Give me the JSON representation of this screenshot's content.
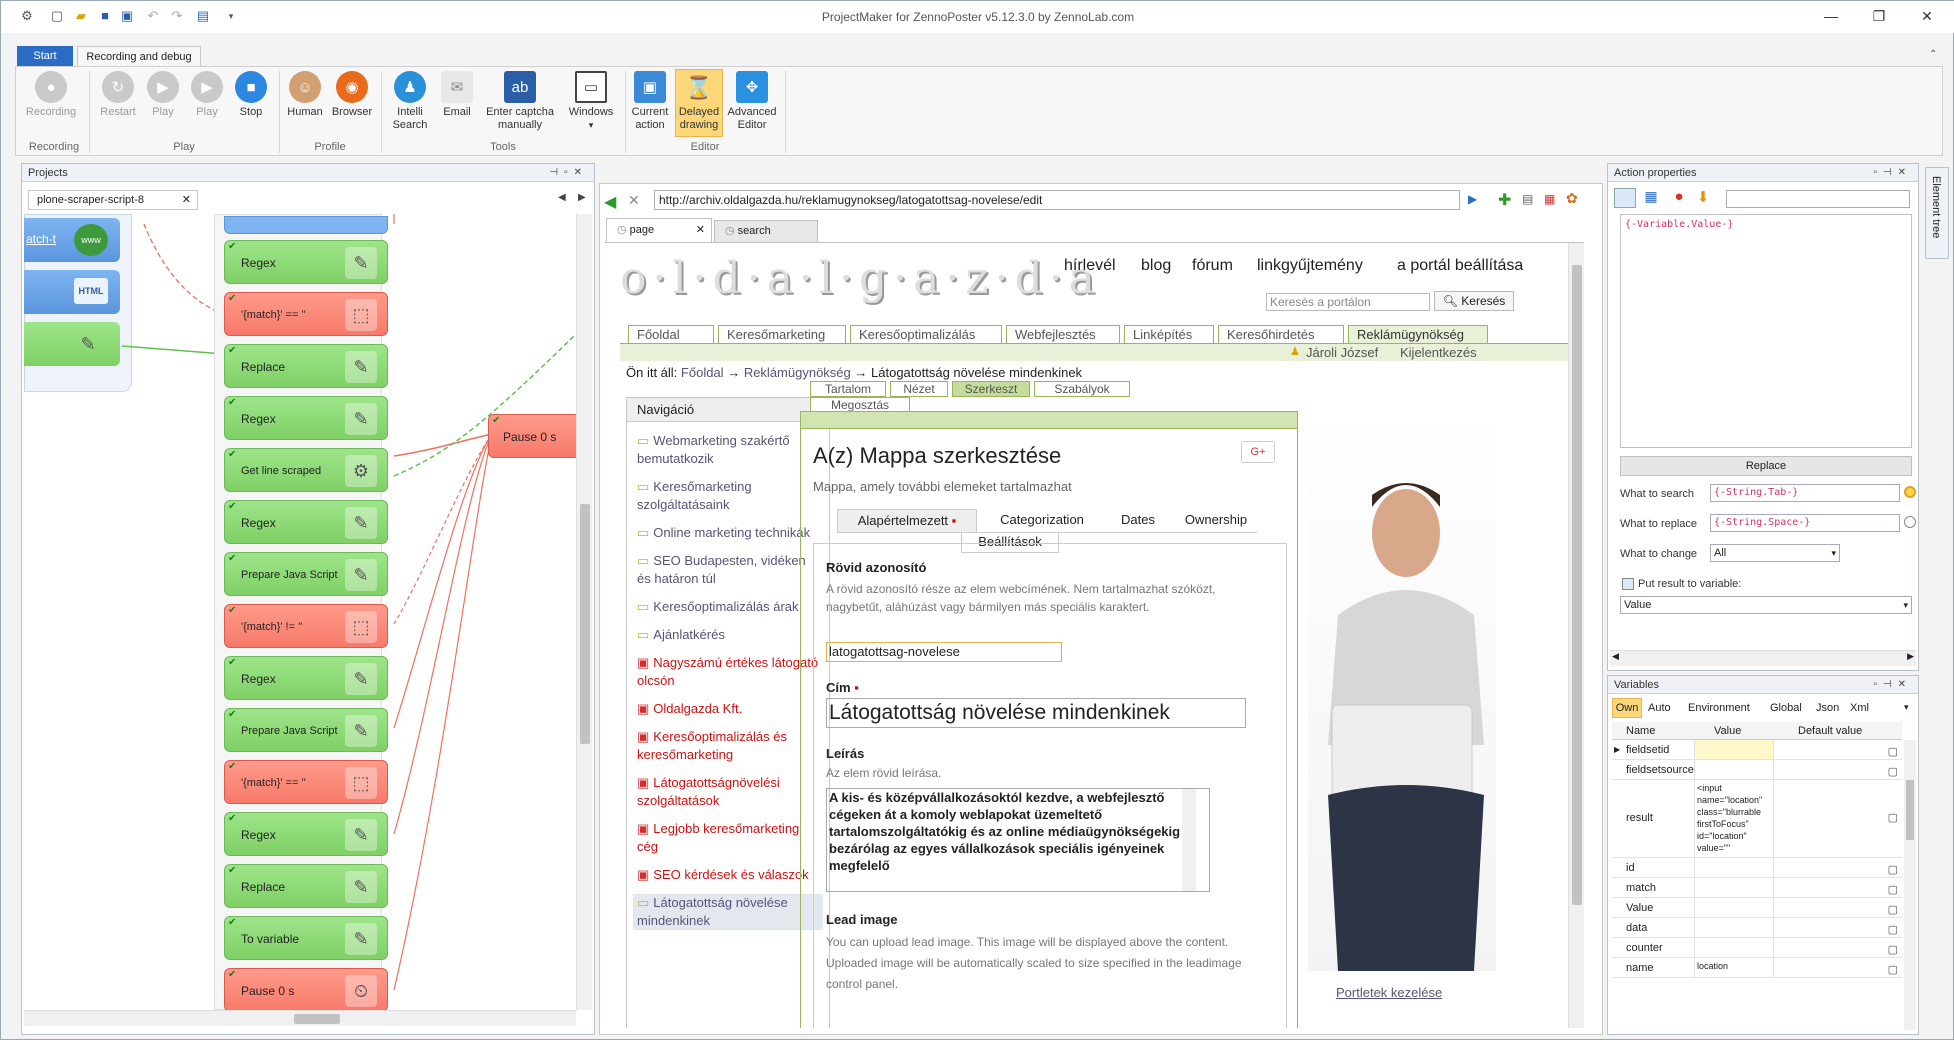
{
  "window": {
    "title": "ProjectMaker for ZennoPoster v5.12.3.0 by ZennoLab.com"
  },
  "ribbon": {
    "tabs": [
      "Start",
      "Recording and debug"
    ],
    "buttons": {
      "recording": "Recording",
      "restart": "Restart",
      "play": "Play",
      "play2": "Play",
      "stop": "Stop",
      "human": "Human",
      "browser": "Browser",
      "intelli1": "Intelli",
      "intelli2": "Search",
      "email": "Email",
      "captcha1": "Enter captcha",
      "captcha2": "manually",
      "windows": "Windows",
      "current1": "Current",
      "current2": "action",
      "delayed1": "Delayed",
      "delayed2": "drawing",
      "advanced1": "Advanced",
      "advanced2": "Editor"
    },
    "groups": {
      "recording": "Recording",
      "play": "Play",
      "profile": "Profile",
      "tools": "Tools",
      "editor": "Editor"
    }
  },
  "projects": {
    "header": "Projects",
    "tab": "plone-scraper-script-8",
    "left_nodes": [
      "atch-t",
      "HTML"
    ],
    "nodes": [
      "Regex",
      "'{match}' == ''",
      "Replace",
      "Regex",
      "Get line scraped",
      "Regex",
      "Prepare Java Script",
      "'{match}' != ''",
      "Regex",
      "Prepare Java Script",
      "'{match}' == ''",
      "Regex",
      "Replace",
      "To variable",
      "Pause 0 s"
    ],
    "pause_node": "Pause 0 s"
  },
  "browser": {
    "url": "http://archiv.oldalgazda.hu/reklamugynokseg/latogatottsag-novelese/edit",
    "tabs": [
      "page",
      "search"
    ],
    "site": {
      "logo": "o·l·d·a·l·g·a·z·d·a",
      "top_links": [
        "hírlevél",
        "blog",
        "fórum",
        "linkgyűjtemény",
        "a portál beállítása"
      ],
      "search_placeholder": "Keresés a portálon",
      "search_button": "Keresés",
      "main_tabs": [
        "Főoldal",
        "Keresőmarketing",
        "Keresőoptimalizálás",
        "Webfejlesztés",
        "Linképítés",
        "Keresőhirdetés",
        "Reklámügynökség"
      ],
      "user": "Jároli József",
      "logout": "Kijelentkezés",
      "breadcrumb_prefix": "Ön itt áll:",
      "breadcrumb": [
        "Főoldal",
        "Reklámügynökség",
        "Látogatottság növelése mindenkinek"
      ],
      "breadcrumb_sep": "→",
      "nav_title": "Navigáció",
      "nav_items": [
        {
          "text": "Webmarketing szakértő bemutatkozik",
          "red": false
        },
        {
          "text": "Keresőmarketing szolgáltatásaink",
          "red": false
        },
        {
          "text": "Online marketing technikák",
          "red": false
        },
        {
          "text": "SEO Budapesten, vidéken és határon túl",
          "red": false
        },
        {
          "text": "Keresőoptimalizálás árak",
          "red": false
        },
        {
          "text": "Ajánlatkérés",
          "red": false
        },
        {
          "text": "Nagyszámú értékes látogató olcsón",
          "red": true
        },
        {
          "text": "Oldalgazda Kft.",
          "red": true
        },
        {
          "text": "Keresőoptimalizálás és keresőmarketing",
          "red": true
        },
        {
          "text": "Látogatottságnövelési szolgáltatások",
          "red": true
        },
        {
          "text": "Legjobb keresőmarketing cég",
          "red": true
        },
        {
          "text": "SEO kérdések és válaszok",
          "red": true
        },
        {
          "text": "Látogatottság növelése mindenkinek",
          "red": false
        }
      ],
      "edit_tabs": [
        "Tartalom",
        "Nézet",
        "Szerkeszt",
        "Szabályok",
        "Megosztás"
      ],
      "heading": "A(z) Mappa szerkesztése",
      "gplus": "G+",
      "subheading": "Mappa, amely további elemeket tartalmazhat",
      "form_tabs": [
        "Alapértelmezett",
        "Categorization",
        "Dates",
        "Ownership",
        "Beállítások"
      ],
      "f_shortid_label": "Rövid azonosító",
      "f_shortid_help": "A rövid azonosító része az elem webcímének. Nem tartalmazhat szóközt, nagybetűt, aláhúzást vagy bármilyen más speciális karaktert.",
      "f_shortid_value": "latogatottsag-novelese",
      "f_title_label": "Cím",
      "f_title_value": "Látogatottság növelése mindenkinek",
      "f_desc_label": "Leírás",
      "f_desc_help": "Az elem rövid leírása.",
      "f_desc_value": "A kis- és középvállalkozásoktól kezdve, a webfejlesztő cégeken át a komoly weblapokat üzemeltető tartalomszolgáltatókig és az online médiaügynökségekig bezárólag az egyes vállalkozások speciális igényeinek megfelelő",
      "f_lead_label": "Lead image",
      "f_lead_help": "You can upload lead image. This image will be displayed above the content. Uploaded image will be automatically scaled to size specified in the leadimage control panel.",
      "portlets": "Portletek kezelése"
    }
  },
  "action_props": {
    "header": "Action properties",
    "editor_text": "{-Variable.Value-}",
    "action": "Replace",
    "search_label": "What to search",
    "search_value": "{-String.Tab-}",
    "replace_label": "What to replace",
    "replace_value": "{-String.Space-}",
    "change_label": "What to change",
    "change_value": "All",
    "put_result": "Put result to variable:",
    "result_var": "Value"
  },
  "variables": {
    "header": "Variables",
    "tabs": [
      "Own",
      "Auto",
      "Environment",
      "Global",
      "Json",
      "Xml"
    ],
    "columns": [
      "Name",
      "Value",
      "Default value"
    ],
    "rows": [
      {
        "name": "fieldsetid",
        "value": ""
      },
      {
        "name": "fieldsetsource",
        "value": ""
      },
      {
        "name": "result",
        "value": "<input name=\"location\" class=\"blurrable firstToFocus\" id=\"location\" value=\"\""
      },
      {
        "name": "id",
        "value": ""
      },
      {
        "name": "match",
        "value": ""
      },
      {
        "name": "Value",
        "value": ""
      },
      {
        "name": "data",
        "value": ""
      },
      {
        "name": "counter",
        "value": ""
      },
      {
        "name": "name",
        "value": "location"
      }
    ]
  },
  "side_tab": "Element tree",
  "colors": {
    "accent": "#2b6cc4",
    "node_green": "#8edb77",
    "node_red": "#f88a7a",
    "site_green": "#98b55b"
  }
}
